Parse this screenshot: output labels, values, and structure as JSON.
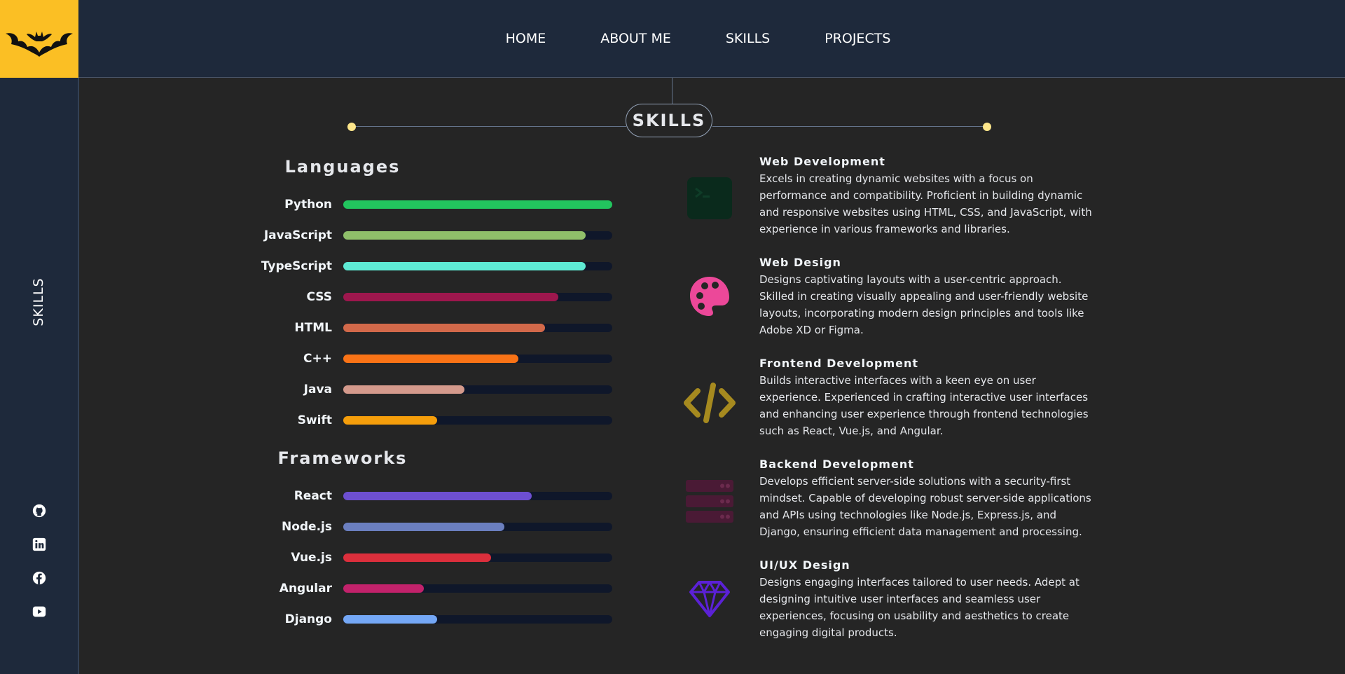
{
  "nav": {
    "items": [
      "HOME",
      "ABOUT ME",
      "SKILLS",
      "PROJECTS"
    ]
  },
  "sidebar": {
    "label": "SKILLS",
    "socials": [
      "github-icon",
      "linkedin-icon",
      "facebook-icon",
      "youtube-icon"
    ]
  },
  "section": {
    "title": "SKILLS"
  },
  "languages": {
    "title": "Languages",
    "items": [
      {
        "name": "Python",
        "level": 1.0,
        "color": "#22c55e"
      },
      {
        "name": "JavaScript",
        "level": 0.9,
        "color": "#8fbf6a"
      },
      {
        "name": "TypeScript",
        "level": 0.9,
        "color": "#5eead4"
      },
      {
        "name": "CSS",
        "level": 0.8,
        "color": "#9d174d"
      },
      {
        "name": "HTML",
        "level": 0.75,
        "color": "#d2694a"
      },
      {
        "name": "C++",
        "level": 0.65,
        "color": "#f97316"
      },
      {
        "name": "Java",
        "level": 0.45,
        "color": "#d49a8c"
      },
      {
        "name": "Swift",
        "level": 0.35,
        "color": "#f59e0b"
      }
    ]
  },
  "frameworks": {
    "title": "Frameworks",
    "items": [
      {
        "name": "React",
        "level": 0.7,
        "color": "#6d4fd0"
      },
      {
        "name": "Node.js",
        "level": 0.6,
        "color": "#6b7fc0"
      },
      {
        "name": "Vue.js",
        "level": 0.55,
        "color": "#dc2f3c"
      },
      {
        "name": "Angular",
        "level": 0.3,
        "color": "#c2226b"
      },
      {
        "name": "Django",
        "level": 0.35,
        "color": "#74a7f5"
      }
    ]
  },
  "services": [
    {
      "title": "Web Development",
      "icon": "terminal-icon",
      "color": "#0a2a1c",
      "desc": "Excels in creating dynamic websites with a focus on performance and compatibility. Proficient in building dynamic and responsive websites using HTML, CSS, and JavaScript, with experience in various frameworks and libraries."
    },
    {
      "title": "Web Design",
      "icon": "palette-icon",
      "color": "#ec4899",
      "desc": "Designs captivating layouts with a user-centric approach. Skilled in creating visually appealing and user-friendly website layouts, incorporating modern design principles and tools like Adobe XD or Figma."
    },
    {
      "title": "Frontend Development",
      "icon": "code-icon",
      "color": "#a68a1f",
      "desc": "Builds interactive interfaces with a keen eye on user experience. Experienced in crafting interactive user interfaces and enhancing user experience through frontend technologies such as React, Vue.js, and Angular."
    },
    {
      "title": "Backend Development",
      "icon": "server-icon",
      "color": "#4a1a35",
      "desc": "Develops efficient server-side solutions with a security-first mindset. Capable of developing robust server-side applications and APIs using technologies like Node.js, Express.js, and Django, ensuring efficient data management and processing."
    },
    {
      "title": "UI/UX Design",
      "icon": "diamond-icon",
      "color": "#5b21d6",
      "desc": "Designs engaging interfaces tailored to user needs. Adept at designing intuitive user interfaces and seamless user experiences, focusing on usability and aesthetics to create engaging digital products."
    }
  ]
}
